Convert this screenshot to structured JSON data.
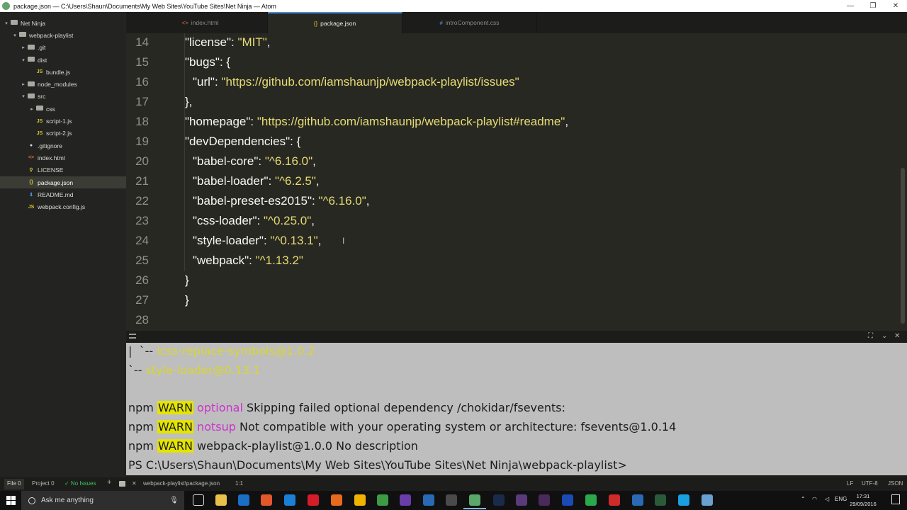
{
  "titlebar": {
    "title": "package.json — C:\\Users\\Shaun\\Documents\\My Web Sites\\YouTube Sites\\Net Ninja — Atom",
    "minimize": "—",
    "restore": "❐",
    "close": "✕"
  },
  "sidebar": {
    "items": [
      {
        "label": "Net Ninja",
        "kind": "folder",
        "expanded": true,
        "depth": 0
      },
      {
        "label": "webpack-playlist",
        "kind": "folder",
        "expanded": true,
        "depth": 1
      },
      {
        "label": ".git",
        "kind": "folder",
        "expanded": false,
        "depth": 2
      },
      {
        "label": "dist",
        "kind": "folder",
        "expanded": true,
        "depth": 2
      },
      {
        "label": "bundle.js",
        "kind": "js",
        "depth": 3
      },
      {
        "label": "node_modules",
        "kind": "folder",
        "expanded": false,
        "depth": 2
      },
      {
        "label": "src",
        "kind": "folder",
        "expanded": true,
        "depth": 2
      },
      {
        "label": "css",
        "kind": "folder",
        "expanded": false,
        "depth": 3
      },
      {
        "label": "script-1.js",
        "kind": "js",
        "depth": 3
      },
      {
        "label": "script-2.js",
        "kind": "js",
        "depth": 3
      },
      {
        "label": ".gitignore",
        "kind": "git",
        "depth": 2
      },
      {
        "label": "index.html",
        "kind": "html",
        "depth": 2
      },
      {
        "label": "LICENSE",
        "kind": "license",
        "depth": 2
      },
      {
        "label": "package.json",
        "kind": "json",
        "depth": 2,
        "selected": true
      },
      {
        "label": "README.md",
        "kind": "md",
        "depth": 2
      },
      {
        "label": "webpack.config.js",
        "kind": "js",
        "depth": 2
      }
    ]
  },
  "tabs": [
    {
      "label": "index.html",
      "icon": "<>",
      "active": false
    },
    {
      "label": "package.json",
      "icon": "{}",
      "active": true
    },
    {
      "label": "introComponent.css",
      "icon": "#",
      "active": false
    }
  ],
  "editor": {
    "lines": [
      {
        "num": "14",
        "indent": 1,
        "parts": [
          [
            "k",
            "\"license\""
          ],
          [
            "p",
            ": "
          ],
          [
            "s",
            "\"MIT\""
          ],
          [
            "p",
            ","
          ]
        ]
      },
      {
        "num": "15",
        "indent": 1,
        "parts": [
          [
            "k",
            "\"bugs\""
          ],
          [
            "p",
            ": {"
          ]
        ]
      },
      {
        "num": "16",
        "indent": 2,
        "parts": [
          [
            "k",
            "\"url\""
          ],
          [
            "p",
            ": "
          ],
          [
            "s",
            "\"https://github.com/iamshaunjp/webpack-playlist/issues\""
          ]
        ]
      },
      {
        "num": "17",
        "indent": 1,
        "parts": [
          [
            "p",
            "},"
          ]
        ]
      },
      {
        "num": "18",
        "indent": 1,
        "parts": [
          [
            "k",
            "\"homepage\""
          ],
          [
            "p",
            ": "
          ],
          [
            "s",
            "\"https://github.com/iamshaunjp/webpack-playlist#readme\""
          ],
          [
            "p",
            ","
          ]
        ]
      },
      {
        "num": "19",
        "indent": 1,
        "parts": [
          [
            "k",
            "\"devDependencies\""
          ],
          [
            "p",
            ": {"
          ]
        ]
      },
      {
        "num": "20",
        "indent": 2,
        "parts": [
          [
            "k",
            "\"babel-core\""
          ],
          [
            "p",
            ": "
          ],
          [
            "s",
            "\"^6.16.0\""
          ],
          [
            "p",
            ","
          ]
        ]
      },
      {
        "num": "21",
        "indent": 2,
        "parts": [
          [
            "k",
            "\"babel-loader\""
          ],
          [
            "p",
            ": "
          ],
          [
            "s",
            "\"^6.2.5\""
          ],
          [
            "p",
            ","
          ]
        ]
      },
      {
        "num": "22",
        "indent": 2,
        "parts": [
          [
            "k",
            "\"babel-preset-es2015\""
          ],
          [
            "p",
            ": "
          ],
          [
            "s",
            "\"^6.16.0\""
          ],
          [
            "p",
            ","
          ]
        ]
      },
      {
        "num": "23",
        "indent": 2,
        "parts": [
          [
            "k",
            "\"css-loader\""
          ],
          [
            "p",
            ": "
          ],
          [
            "s",
            "\"^0.25.0\""
          ],
          [
            "p",
            ","
          ]
        ]
      },
      {
        "num": "24",
        "indent": 2,
        "parts": [
          [
            "k",
            "\"style-loader\""
          ],
          [
            "p",
            ": "
          ],
          [
            "s",
            "\"^0.13.1\""
          ],
          [
            "p",
            ","
          ]
        ]
      },
      {
        "num": "25",
        "indent": 2,
        "parts": [
          [
            "k",
            "\"webpack\""
          ],
          [
            "p",
            ": "
          ],
          [
            "s",
            "\"^1.13.2\""
          ]
        ]
      },
      {
        "num": "26",
        "indent": 1,
        "parts": [
          [
            "p",
            "}"
          ]
        ]
      },
      {
        "num": "27",
        "indent": 0,
        "parts": [
          [
            "p",
            "}"
          ]
        ]
      },
      {
        "num": "28",
        "indent": 0,
        "parts": []
      }
    ]
  },
  "terminal": {
    "lines": [
      [
        [
          "n",
          "|  `-- "
        ],
        [
          "y",
          "icss-replace-symbols@1.0.2"
        ]
      ],
      [
        [
          "n",
          "`-- "
        ],
        [
          "y",
          "style-loader@0.13.1"
        ]
      ],
      [],
      [
        [
          "n",
          "npm "
        ],
        [
          "w",
          "WARN"
        ],
        [
          "n",
          " "
        ],
        [
          "m",
          "optional"
        ],
        [
          "n",
          " Skipping failed optional dependency /chokidar/fsevents:"
        ]
      ],
      [
        [
          "n",
          "npm "
        ],
        [
          "w",
          "WARN"
        ],
        [
          "n",
          " "
        ],
        [
          "m",
          "notsup"
        ],
        [
          "n",
          " Not compatible with your operating system or architecture: fsevents@1.0.14"
        ]
      ],
      [
        [
          "n",
          "npm "
        ],
        [
          "w",
          "WARN"
        ],
        [
          "n",
          " webpack-playlist@1.0.0 No description"
        ]
      ],
      [
        [
          "n",
          "PS C:\\Users\\Shaun\\Documents\\My Web Sites\\YouTube Sites\\Net Ninja\\webpack-playlist>"
        ]
      ]
    ]
  },
  "statusbar": {
    "file": "File 0",
    "project": "Project 0",
    "issues": "✓ No Issues",
    "plus": "+",
    "path": "webpack-playlist\\package.json",
    "cursor": "1:1",
    "line_ending": "LF",
    "encoding": "UTF-8",
    "grammar": "JSON"
  },
  "taskbar": {
    "search_placeholder": "Ask me anything",
    "lang": "ENG",
    "time": "17:31",
    "date": "29/09/2016"
  }
}
